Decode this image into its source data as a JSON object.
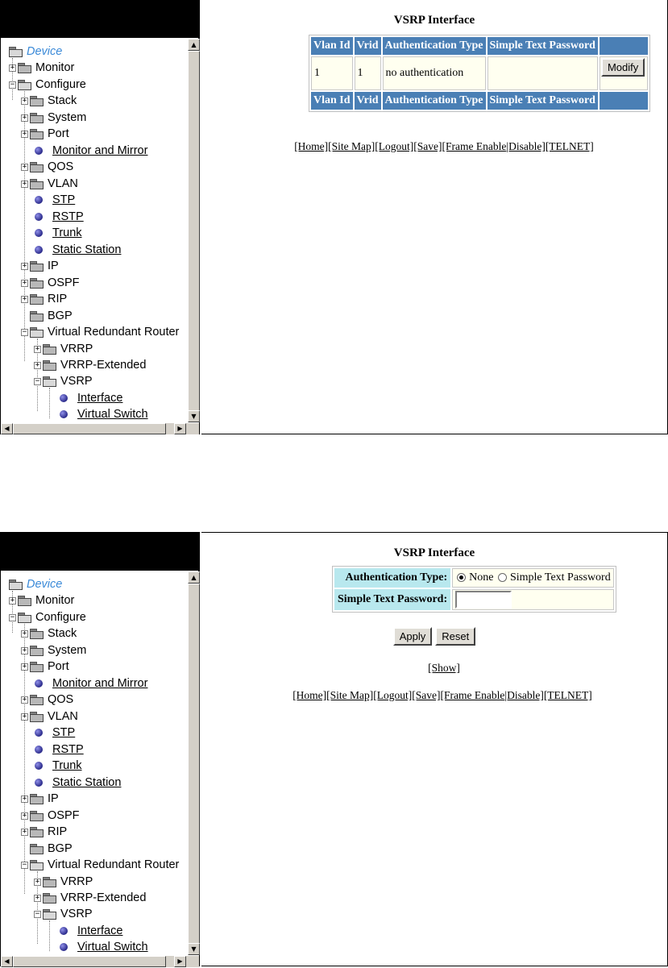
{
  "tree": {
    "device": "Device",
    "monitor": "Monitor",
    "configure": "Configure",
    "stack": "Stack",
    "system": "System",
    "port": "Port",
    "monitor_and_mirror": "Monitor and Mirror",
    "qos": "QOS",
    "vlan": "VLAN",
    "stp": "STP",
    "rstp": "RSTP",
    "trunk": "Trunk",
    "static_station": "Static Station",
    "ip": "IP",
    "ospf": "OSPF",
    "rip": "RIP",
    "bgp": "BGP",
    "virtual_redundant_router": "Virtual Redundant Router",
    "vrrp": "VRRP",
    "vrrp_extended": "VRRP-Extended",
    "vsrp": "VSRP",
    "interface": "Interface",
    "virtual_switch": "Virtual Switch"
  },
  "screen1": {
    "title": "VSRP Interface",
    "headers": [
      "Vlan Id",
      "Vrid",
      "Authentication Type",
      "Simple Text Password",
      ""
    ],
    "row": {
      "vlan_id": "1",
      "vrid": "1",
      "auth_type": "no authentication",
      "password": ""
    },
    "modify_button": "Modify"
  },
  "screen2": {
    "title": "VSRP Interface",
    "auth_type_label": "Authentication Type:",
    "option_none": "None",
    "option_simple": "Simple Text Password",
    "selected_option": "None",
    "password_label": "Simple Text Password:",
    "password_value": "",
    "apply_button": "Apply",
    "reset_button": "Reset",
    "show_link": "[Show]"
  },
  "nav": {
    "home": "[Home]",
    "site_map": "[Site Map]",
    "logout": "[Logout]",
    "save": "[Save]",
    "frame_enable": "[Frame Enable",
    "disable": "|Disable]",
    "telnet": "[TELNET]"
  },
  "icons": {
    "folder": "folder-icon",
    "leaf": "bullet-icon",
    "expander": "plus-expander-icon"
  }
}
